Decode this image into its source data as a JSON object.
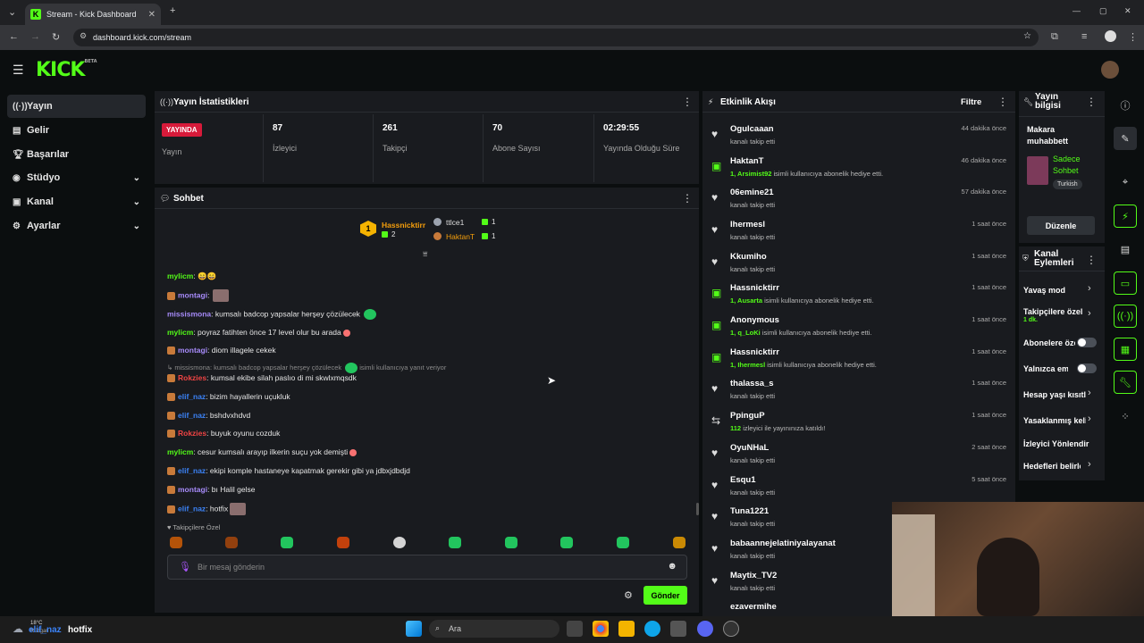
{
  "browser": {
    "tab_title": "Stream - Kick Dashboard",
    "url": "dashboard.kick.com/stream"
  },
  "brand": {
    "logo": "KICK",
    "beta": "BETA",
    "accent": "#53fc18"
  },
  "sidebar": {
    "items": [
      {
        "label": "Yayın",
        "icon": "broadcast-icon"
      },
      {
        "label": "Gelir",
        "icon": "revenue-icon"
      },
      {
        "label": "Başarılar",
        "icon": "trophy-icon"
      },
      {
        "label": "Stüdyo",
        "icon": "studio-icon"
      },
      {
        "label": "Kanal",
        "icon": "channel-icon"
      },
      {
        "label": "Ayarlar",
        "icon": "gear-icon"
      }
    ]
  },
  "stats": {
    "title": "Yayın İstatistikleri",
    "live_badge": "YAYINDA",
    "live_label": "Yayın",
    "items": [
      {
        "value": "87",
        "label": "İzleyici"
      },
      {
        "value": "261",
        "label": "Takipçi"
      },
      {
        "value": "70",
        "label": "Abone Sayısı"
      },
      {
        "value": "02:29:55",
        "label": "Yayında Olduğu Süre"
      }
    ]
  },
  "chat": {
    "title": "Sohbet",
    "leaderboard": {
      "first_rank": "1",
      "first_name": "Hassnicktirr",
      "first_count": "2",
      "second_name": "ttlce1",
      "second_count": "1",
      "third_name": "HaktanT",
      "third_count": "1"
    },
    "messages": [
      {
        "user": "mylicm",
        "text": ": 😄😄"
      },
      {
        "user": "montagi",
        "text": ":"
      },
      {
        "user": "missismona",
        "text": ": kumsalı badcop yapsalar herşey çözülecek"
      },
      {
        "user": "mylicm",
        "text": ": poyraz fatihten önce 17 level olur bu arada"
      },
      {
        "user": "montagi",
        "text": ": diom illagele cekek"
      },
      {
        "user": "missismona: kumsalı badcop yapsalar herşey çözülecek",
        "text": "isimli kullanıcıya yanıt veriyor"
      },
      {
        "user": "Rokzies",
        "text": ": kumsal ekibe silah paslıo di mi skwlxmqsdk"
      },
      {
        "user": "elif_naz",
        "text": ": bizim hayallerin uçukluk"
      },
      {
        "user": "elif_naz",
        "text": ": bshdvxhdvd"
      },
      {
        "user": "Rokzies",
        "text": ": buyuk oyunu cozduk"
      },
      {
        "user": "mylicm",
        "text": ": cesur kumsalı arayıp ilkerin suçu yok demişti"
      },
      {
        "user": "elif_naz",
        "text": ": ekipi komple hastaneye kapatmak gerekir gibi ya jdbxjdbdjd"
      },
      {
        "user": "montagi",
        "text": ": bı Halil gelse"
      },
      {
        "user": "elif_naz",
        "text": ": hotfix"
      }
    ],
    "emote_section": "Takipçilere Özel",
    "input_placeholder": "Bir mesaj gönderin",
    "send_label": "Gönder"
  },
  "events": {
    "title": "Etkinlik Akışı",
    "filter_label": "Filtre",
    "items": [
      {
        "name": "Ogulcaaan",
        "sub": "kanalı takip etti",
        "time": "44 dakika önce",
        "kind": "follow"
      },
      {
        "name": "HaktanT",
        "sub_hl": "1, Arsimist92",
        "sub": "isimli kullanıcıya abonelik hediye etti.",
        "time": "46 dakika önce",
        "kind": "gift"
      },
      {
        "name": "06emine21",
        "sub": "kanalı takip etti",
        "time": "57 dakika önce",
        "kind": "follow"
      },
      {
        "name": "Ihermesl",
        "sub": "kanalı takip etti",
        "time": "1 saat önce",
        "kind": "follow"
      },
      {
        "name": "Kkumiho",
        "sub": "kanalı takip etti",
        "time": "1 saat önce",
        "kind": "follow"
      },
      {
        "name": "Hassnicktirr",
        "sub_hl": "1, Ausarta",
        "sub": "isimli kullanıcıya abonelik hediye etti.",
        "time": "1 saat önce",
        "kind": "gift"
      },
      {
        "name": "Anonymous",
        "sub_hl": "1, q_LoKi",
        "sub": "isimli kullanıcıya abonelik hediye etti.",
        "time": "1 saat önce",
        "kind": "gift"
      },
      {
        "name": "Hassnicktirr",
        "sub_hl": "1, Ihermesl",
        "sub": "isimli kullanıcıya abonelik hediye etti.",
        "time": "1 saat önce",
        "kind": "gift"
      },
      {
        "name": "thalassa_s",
        "sub": "kanalı takip etti",
        "time": "1 saat önce",
        "kind": "follow"
      },
      {
        "name": "PpinguP",
        "sub_hl": "112",
        "sub": "izleyici ile yayınınıza katıldı!",
        "time": "1 saat önce",
        "kind": "host"
      },
      {
        "name": "OyuNHaL",
        "sub": "kanalı takip etti",
        "time": "2 saat önce",
        "kind": "follow"
      },
      {
        "name": "Esqu1",
        "sub": "kanalı takip etti",
        "time": "5 saat önce",
        "kind": "follow"
      },
      {
        "name": "Tuna1221",
        "sub": "kanalı takip etti",
        "time": "",
        "kind": "follow"
      },
      {
        "name": "babaannejelatiniyalayanat",
        "sub": "kanalı takip etti",
        "time": "",
        "kind": "follow"
      },
      {
        "name": "Maytix_TV2",
        "sub": "kanalı takip etti",
        "time": "",
        "kind": "follow"
      },
      {
        "name": "ezavermihe",
        "sub": "",
        "time": "",
        "kind": "follow"
      }
    ]
  },
  "stream_info": {
    "title": "Yayın bilgisi",
    "stream_title": "Makara muhabbett",
    "category": "Sadece Sohbet",
    "language": "Turkish",
    "edit_label": "Düzenle"
  },
  "channel_actions": {
    "title": "Kanal Eylemleri",
    "items": [
      {
        "label": "Yavaş mod",
        "control": "chevron"
      },
      {
        "label": "Takipçilere özel",
        "sub": "1 dk.",
        "control": "chevron"
      },
      {
        "label": "Abonelere özel",
        "control": "toggle"
      },
      {
        "label": "Yalnızca emote",
        "control": "toggle"
      },
      {
        "label": "Hesap yaşı kısıtlaması",
        "control": "chevron"
      },
      {
        "label": "Yasaklanmış kelimeler",
        "control": "chevron"
      },
      {
        "label": "İzleyici Yönlendir",
        "control": "none"
      },
      {
        "label": "Hedefleri belirle",
        "control": "chevron"
      }
    ]
  },
  "taskbar": {
    "weather_temp": "18°C",
    "weather_desc": "Rüzgar",
    "overlay_user": "elif_naz",
    "overlay_text": "hotfix",
    "search_placeholder": "Ara"
  }
}
